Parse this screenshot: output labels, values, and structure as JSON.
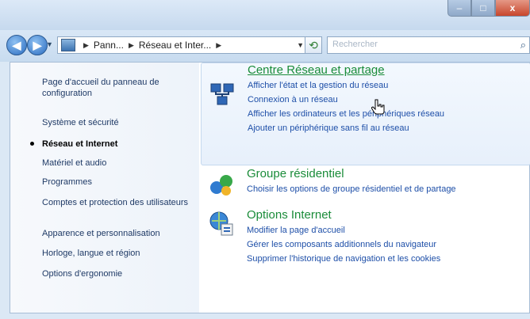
{
  "window": {
    "controls": {
      "minimize": "–",
      "maximize": "□",
      "close": "x"
    }
  },
  "address_bar": {
    "back_icon": "arrow-left",
    "forward_icon": "arrow-right",
    "crumbs": [
      "Pann...",
      "Réseau et Inter..."
    ],
    "refresh_icon": "refresh",
    "search_placeholder": "Rechercher",
    "search_icon": "magnifier"
  },
  "sidebar": {
    "items": [
      {
        "label": "Page d'accueil du panneau de configuration"
      },
      {
        "label": "Système et sécurité"
      },
      {
        "label": "Réseau et Internet",
        "active": true
      },
      {
        "label": "Matériel et audio"
      },
      {
        "label": "Programmes"
      },
      {
        "label": "Comptes et protection des utilisateurs"
      },
      {
        "label": "Apparence et personnalisation"
      },
      {
        "label": "Horloge, langue et région"
      },
      {
        "label": "Options d'ergonomie"
      }
    ]
  },
  "main": {
    "sections": [
      {
        "title": "Centre Réseau et partage",
        "icon": "network-icon",
        "links": [
          "Afficher l'état et la gestion du réseau",
          "Connexion à un réseau",
          "Afficher les ordinateurs et les périphériques réseau",
          "Ajouter un périphérique sans fil au réseau"
        ]
      },
      {
        "title": "Groupe résidentiel",
        "icon": "homegroup-icon",
        "links": [
          "Choisir les options de groupe résidentiel et de partage"
        ]
      },
      {
        "title": "Options Internet",
        "icon": "internet-options-icon",
        "links": [
          "Modifier la page d'accueil",
          "Gérer les composants additionnels du navigateur",
          "Supprimer l'historique de navigation et les cookies"
        ]
      }
    ]
  }
}
